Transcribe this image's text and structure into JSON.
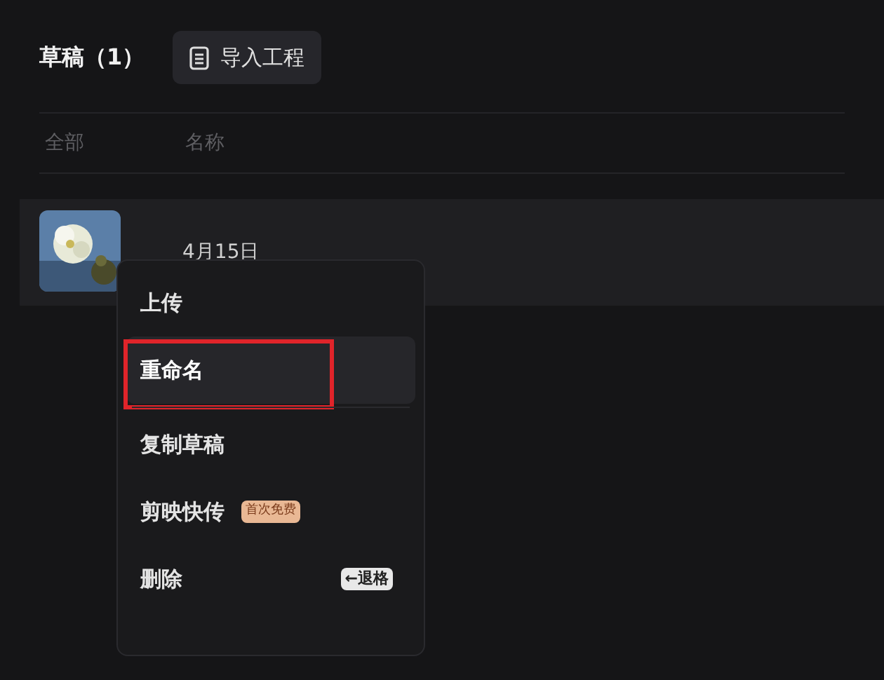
{
  "header": {
    "title": "草稿（1）",
    "import_button": "导入工程"
  },
  "table": {
    "columns": [
      "全部",
      "名称"
    ],
    "rows": [
      {
        "kind": "picture",
        "name": "4月15日"
      }
    ]
  },
  "context_menu": {
    "items": [
      {
        "label": "上传",
        "selected": false
      },
      {
        "label": "重命名",
        "selected": true,
        "highlighted_frame": true
      },
      {
        "label": "复制草稿",
        "selected": false
      },
      {
        "label": "剪映快传",
        "selected": false,
        "badge": "首次免费"
      },
      {
        "label": "删除",
        "selected": false,
        "shortcut": "←退格"
      }
    ]
  }
}
